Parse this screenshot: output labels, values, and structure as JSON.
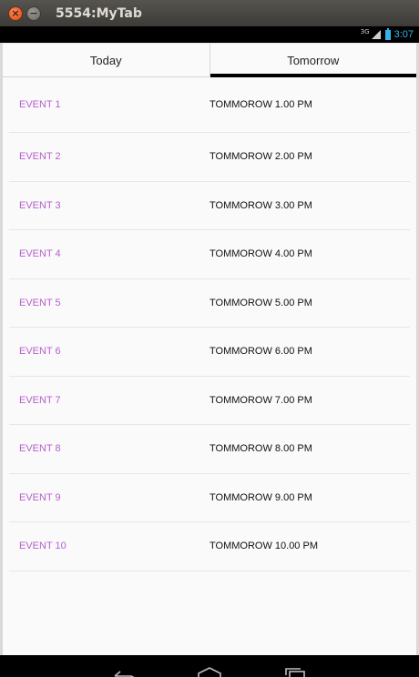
{
  "window": {
    "title": "5554:MyTab",
    "close_glyph": "×",
    "minimize_glyph": "−"
  },
  "statusbar": {
    "network": "3G",
    "time": "3:07",
    "accent": "#33b5e5"
  },
  "tabs": [
    {
      "label": "Today",
      "active": false
    },
    {
      "label": "Tomorrow",
      "active": true
    }
  ],
  "events": [
    {
      "name": "EVENT 1",
      "time": "TOMMOROW 1.00 PM"
    },
    {
      "name": "EVENT 2",
      "time": "TOMMOROW 2.00 PM"
    },
    {
      "name": "EVENT 3",
      "time": "TOMMOROW 3.00 PM"
    },
    {
      "name": "EVENT 4",
      "time": "TOMMOROW 4.00 PM"
    },
    {
      "name": "EVENT 5",
      "time": "TOMMOROW 5.00 PM"
    },
    {
      "name": "EVENT 6",
      "time": "TOMMOROW 6.00 PM"
    },
    {
      "name": "EVENT 7",
      "time": "TOMMOROW 7.00 PM"
    },
    {
      "name": "EVENT 8",
      "time": "TOMMOROW 8.00 PM"
    },
    {
      "name": "EVENT 9",
      "time": "TOMMOROW 9.00 PM"
    },
    {
      "name": "EVENT 10",
      "time": "TOMMOROW 10.00 PM"
    }
  ],
  "colors": {
    "event_name": "#b660cd",
    "tab_indicator": "#000000"
  },
  "navbar": {
    "icons": [
      "back-icon",
      "home-icon",
      "recents-icon"
    ]
  }
}
